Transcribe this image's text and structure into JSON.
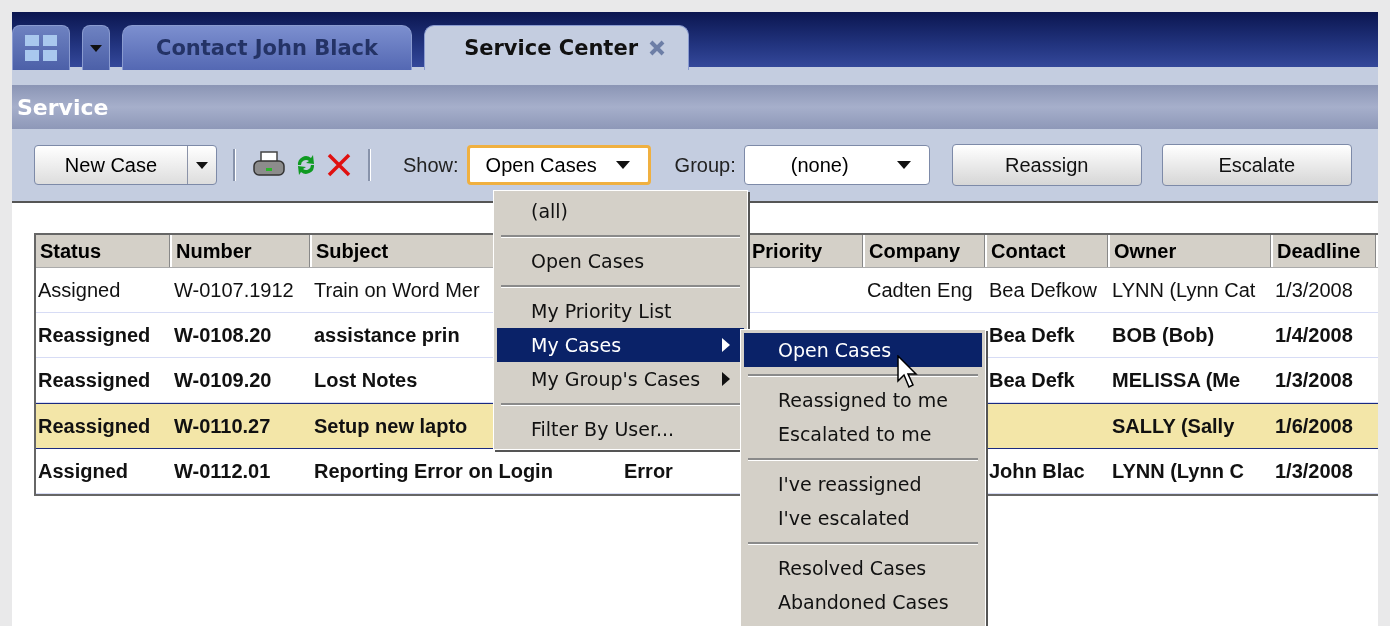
{
  "tabs": [
    {
      "label": "Contact John Black",
      "selected": false
    },
    {
      "label": "Service Center",
      "selected": true
    }
  ],
  "panel_title": "Service",
  "toolbar": {
    "new_case": "New Case",
    "show_label": "Show:",
    "show_value": "Open Cases",
    "group_label": "Group:",
    "group_value": "(none)",
    "buttons": [
      "Reassign",
      "Escalate"
    ]
  },
  "table": {
    "columns": [
      "Status",
      "Number",
      "Subject",
      null,
      "Priority",
      "Company",
      "Contact",
      "Owner",
      "Deadline"
    ],
    "rows": [
      {
        "selected": false,
        "unread": false,
        "cells": [
          "Assigned",
          "W-0107.1912",
          "Train on Word Mer",
          null,
          null,
          "Cadten Eng",
          "Bea Defkow",
          "LYNN (Lynn Cat",
          "1/3/2008"
        ]
      },
      {
        "selected": false,
        "unread": true,
        "cells": [
          "Reassigned",
          "W-0108.20",
          "assistance prin",
          null,
          null,
          null,
          "Bea Defk",
          "BOB (Bob)",
          "1/4/2008"
        ]
      },
      {
        "selected": false,
        "unread": true,
        "cells": [
          "Reassigned",
          "W-0109.20",
          "Lost Notes",
          null,
          null,
          null,
          "Bea Defk",
          "MELISSA (Me",
          "1/3/2008"
        ]
      },
      {
        "selected": true,
        "unread": true,
        "cells": [
          "Reassigned",
          "W-0110.27",
          "Setup new lapto",
          null,
          null,
          null,
          null,
          "SALLY (Sally",
          "1/6/2008"
        ]
      },
      {
        "selected": false,
        "unread": true,
        "cells": [
          "Assigned",
          "W-0112.01",
          "Reporting Error on Login",
          "Error",
          null,
          null,
          "John Blac",
          "LYNN (Lynn C",
          "1/3/2008"
        ]
      }
    ]
  },
  "show_menu": {
    "items": [
      {
        "kind": "item",
        "label": "(all)",
        "selected": false
      },
      {
        "kind": "separator"
      },
      {
        "kind": "item",
        "label": "Open Cases",
        "selected": false
      },
      {
        "kind": "separator"
      },
      {
        "kind": "item",
        "label": "My Priority List",
        "selected": false
      },
      {
        "kind": "item",
        "label": "My Cases",
        "selected": true,
        "submenu": true,
        "children": [
          {
            "kind": "item",
            "label": "Open Cases",
            "selected": true
          },
          {
            "kind": "separator"
          },
          {
            "kind": "item",
            "label": "Reassigned to me",
            "selected": false
          },
          {
            "kind": "item",
            "label": "Escalated to me",
            "selected": false
          },
          {
            "kind": "separator"
          },
          {
            "kind": "item",
            "label": "I've reassigned",
            "selected": false
          },
          {
            "kind": "item",
            "label": "I've escalated",
            "selected": false
          },
          {
            "kind": "separator"
          },
          {
            "kind": "item",
            "label": "Resolved Cases",
            "selected": false
          },
          {
            "kind": "item",
            "label": "Abandoned Cases",
            "selected": false
          }
        ]
      },
      {
        "kind": "item",
        "label": "My Group's Cases",
        "selected": false,
        "submenu": true
      },
      {
        "kind": "separator"
      },
      {
        "kind": "item",
        "label": "Filter By User...",
        "selected": false
      }
    ]
  }
}
